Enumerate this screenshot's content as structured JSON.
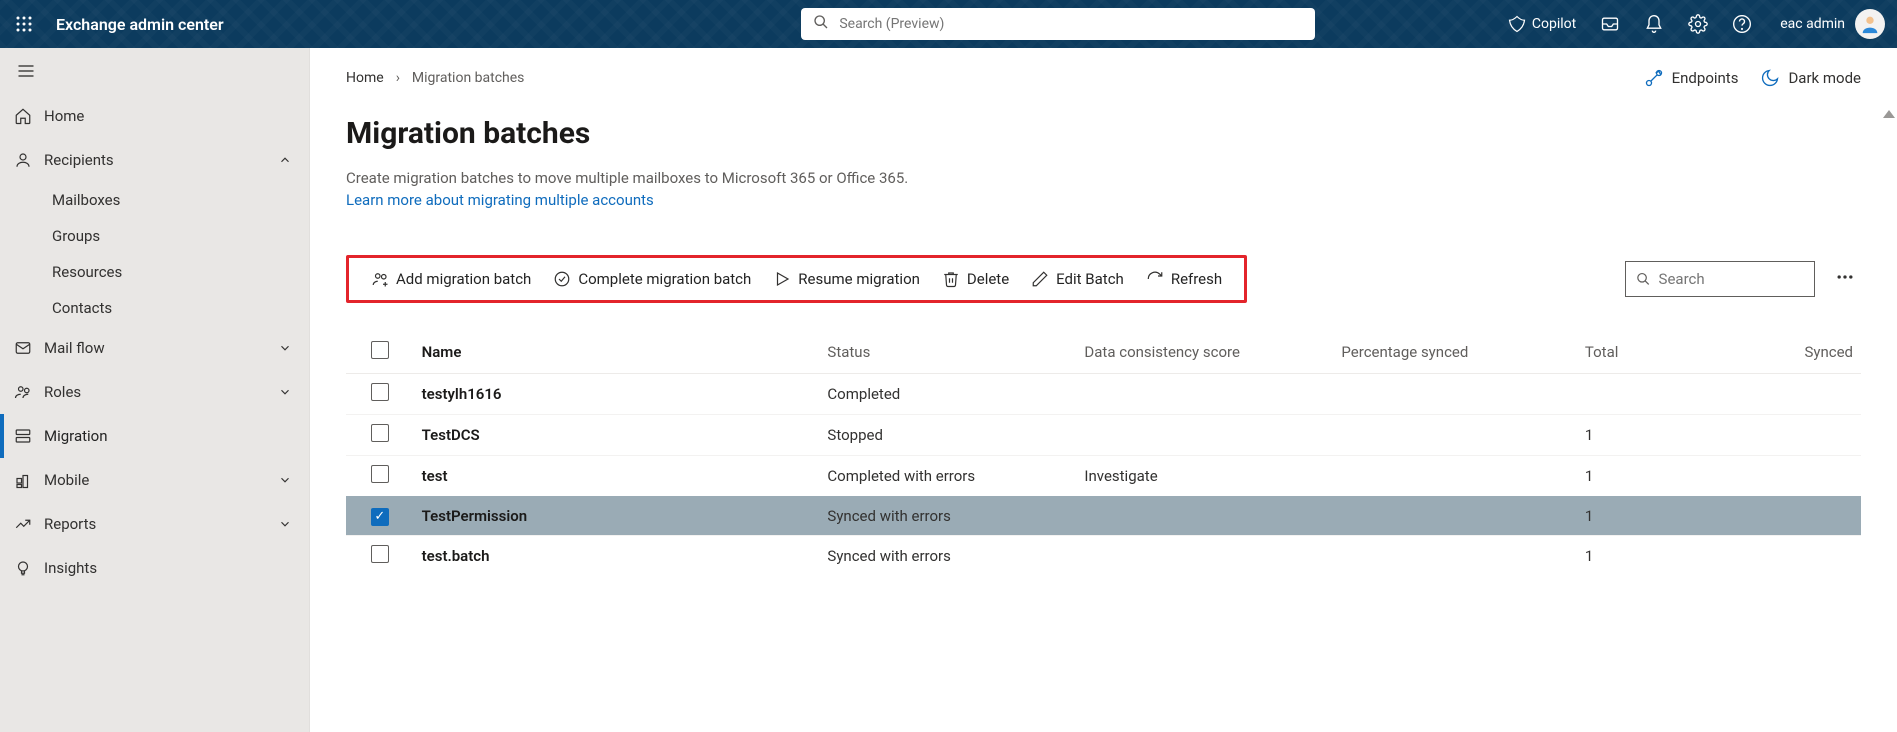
{
  "app_title": "Exchange admin center",
  "search": {
    "placeholder": "Search (Preview)"
  },
  "copilot_label": "Copilot",
  "user_name": "eac admin",
  "breadcrumb": {
    "home": "Home",
    "current": "Migration batches"
  },
  "header_links": {
    "endpoints": "Endpoints",
    "dark_mode": "Dark mode"
  },
  "nav": {
    "home": "Home",
    "recipients": "Recipients",
    "mailboxes": "Mailboxes",
    "groups": "Groups",
    "resources": "Resources",
    "contacts": "Contacts",
    "mail_flow": "Mail flow",
    "roles": "Roles",
    "migration": "Migration",
    "mobile": "Mobile",
    "reports": "Reports",
    "insights": "Insights"
  },
  "page": {
    "title": "Migration batches",
    "description": "Create migration batches to move multiple mailboxes to Microsoft 365 or Office 365.",
    "learn_more": "Learn more about migrating multiple accounts"
  },
  "commands": {
    "add": "Add migration batch",
    "complete": "Complete migration batch",
    "resume": "Resume migration",
    "delete": "Delete",
    "edit": "Edit Batch",
    "refresh": "Refresh"
  },
  "table_search": {
    "placeholder": "Search"
  },
  "columns": {
    "name": "Name",
    "status": "Status",
    "dcs": "Data consistency score",
    "pct": "Percentage synced",
    "total": "Total",
    "synced": "Synced"
  },
  "rows": [
    {
      "selected": false,
      "name": "testylh1616",
      "status": "Completed",
      "dcs": "",
      "pct": "",
      "total": "",
      "synced": ""
    },
    {
      "selected": false,
      "name": "TestDCS",
      "status": "Stopped",
      "dcs": "",
      "pct": "",
      "total": "1",
      "synced": ""
    },
    {
      "selected": false,
      "name": "test",
      "status": "Completed with errors",
      "dcs": "Investigate",
      "pct": "",
      "total": "1",
      "synced": ""
    },
    {
      "selected": true,
      "name": "TestPermission",
      "status": "Synced with errors",
      "dcs": "",
      "pct": "",
      "total": "1",
      "synced": ""
    },
    {
      "selected": false,
      "name": "test.batch",
      "status": "Synced with errors",
      "dcs": "",
      "pct": "",
      "total": "1",
      "synced": ""
    }
  ]
}
